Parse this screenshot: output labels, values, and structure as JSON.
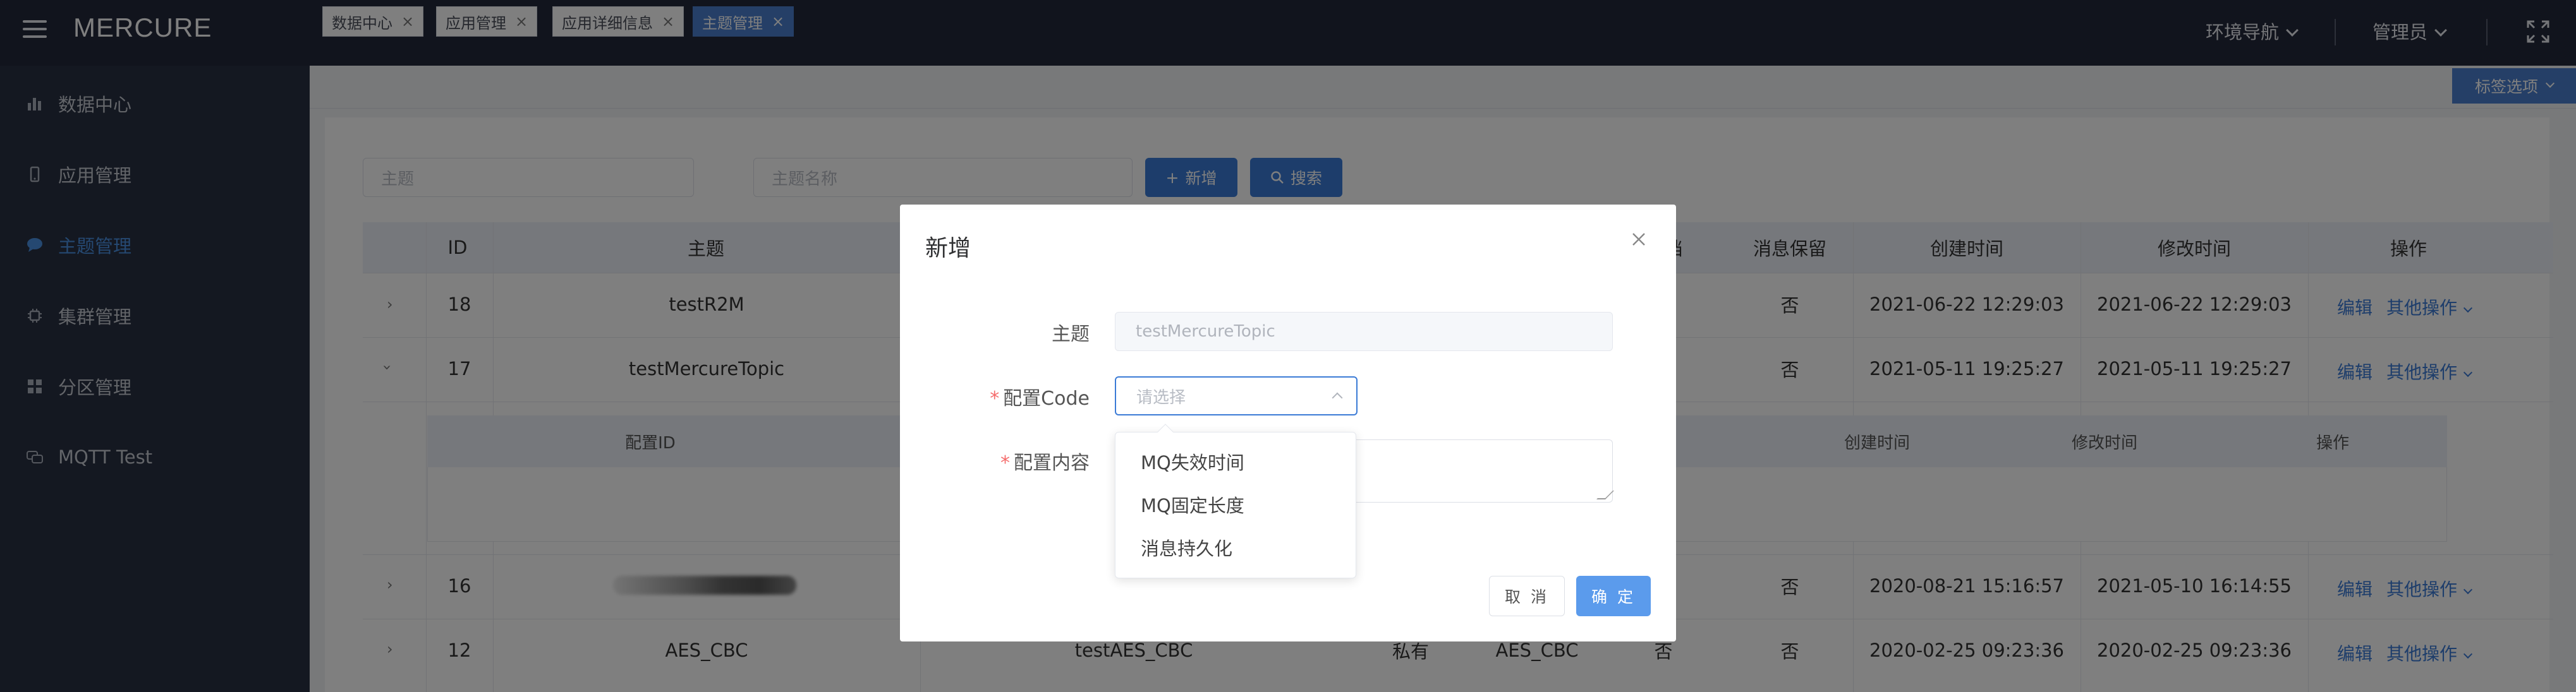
{
  "app": {
    "title": "MERCURE"
  },
  "topbar": {
    "env_nav": "环境导航",
    "admin": "管理员"
  },
  "sidebar": {
    "items": [
      {
        "label": "数据中心",
        "icon": "bar-chart-icon"
      },
      {
        "label": "应用管理",
        "icon": "phone-icon"
      },
      {
        "label": "主题管理",
        "icon": "chat-bubble-icon"
      },
      {
        "label": "集群管理",
        "icon": "chip-icon"
      },
      {
        "label": "分区管理",
        "icon": "grid-icon"
      },
      {
        "label": "MQTT Test",
        "icon": "chat-icon"
      }
    ]
  },
  "tabs": [
    {
      "label": "数据中心"
    },
    {
      "label": "应用管理"
    },
    {
      "label": "应用详细信息"
    },
    {
      "label": "主题管理"
    }
  ],
  "tag_options": "标签选项",
  "search": {
    "topic_placeholder": "主题",
    "topic_name_placeholder": "主题名称",
    "add_label": "新增",
    "search_label": "搜索"
  },
  "table": {
    "headers": {
      "id": "ID",
      "topic": "主题",
      "archive": "档",
      "retain": "消息保留",
      "created": "创建时间",
      "modified": "修改时间",
      "ops": "操作"
    },
    "rows": [
      {
        "id": "18",
        "topic": "testR2M",
        "retain": "否",
        "created": "2021-06-22 12:29:03",
        "modified": "2021-06-22 12:29:03"
      },
      {
        "id": "17",
        "topic": "testMercureTopic",
        "retain": "否",
        "created": "2021-05-11 19:25:27",
        "modified": "2021-05-11 19:25:27"
      },
      {
        "id": "16",
        "topic": "",
        "retain": "否",
        "created": "2020-08-21 15:16:57",
        "modified": "2021-05-10 16:14:55"
      },
      {
        "id": "12",
        "topic": "AES_CBC",
        "topic_name": "testAES_CBC",
        "visibility": "私有",
        "algo": "AES_CBC",
        "archive": "否",
        "retain": "否",
        "created": "2020-02-25 09:23:36",
        "modified": "2020-02-25 09:23:36"
      }
    ],
    "edit_label": "编辑",
    "more_label": "其他操作",
    "subtable": {
      "config_id": "配置ID",
      "created": "创建时间",
      "modified": "修改时间",
      "ops": "操作"
    }
  },
  "modal": {
    "title": "新增",
    "topic_label": "主题",
    "topic_value": "testMercureTopic",
    "config_code_label": "配置Code",
    "config_code_placeholder": "请选择",
    "config_content_label": "配置内容",
    "cancel": "取 消",
    "ok": "确 定"
  },
  "dropdown": {
    "options": [
      "MQ失效时间",
      "MQ固定长度",
      "消息持久化"
    ]
  }
}
